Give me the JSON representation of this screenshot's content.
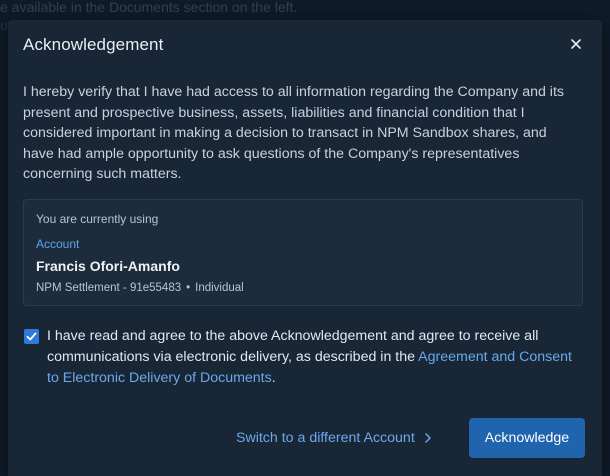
{
  "background": {
    "line1": "e available in the Documents section on the left.",
    "line2": "ut is held on your behalf by SA Equiti"
  },
  "modal": {
    "title": "Acknowledgement",
    "close_icon": "close-icon",
    "body_text": "I hereby verify that I have had access to all information regarding the Company and its present and prospective business, assets, liabilities and financial condition that I considered important in making a decision to transact in NPM Sandbox shares, and have had ample opportunity to ask questions of the Company's representatives concerning such matters."
  },
  "account_card": {
    "using_label": "You are currently using",
    "account_label": "Account",
    "name": "Francis Ofori-Amanfo",
    "account_number": "NPM Settlement - 91e55483",
    "separator": "•",
    "account_type": "Individual"
  },
  "consent": {
    "checked": true,
    "text_before": "I have read and agree to the above Acknowledgement and agree to receive all communications via electronic delivery, as described in the ",
    "link_text": "Agreement and Consent to Electronic Delivery of Documents",
    "text_after": "."
  },
  "actions": {
    "switch_account_label": "Switch to a different Account",
    "switch_account_icon": "chevron-right-icon",
    "acknowledge_label": "Acknowledge"
  },
  "colors": {
    "page_background": "#0f1b29",
    "modal_background": "#182635",
    "card_background": "#1d2c3c",
    "accent_link": "#6aa9ec",
    "primary_button": "#1f64ac",
    "checkbox": "#2f7ad6"
  }
}
